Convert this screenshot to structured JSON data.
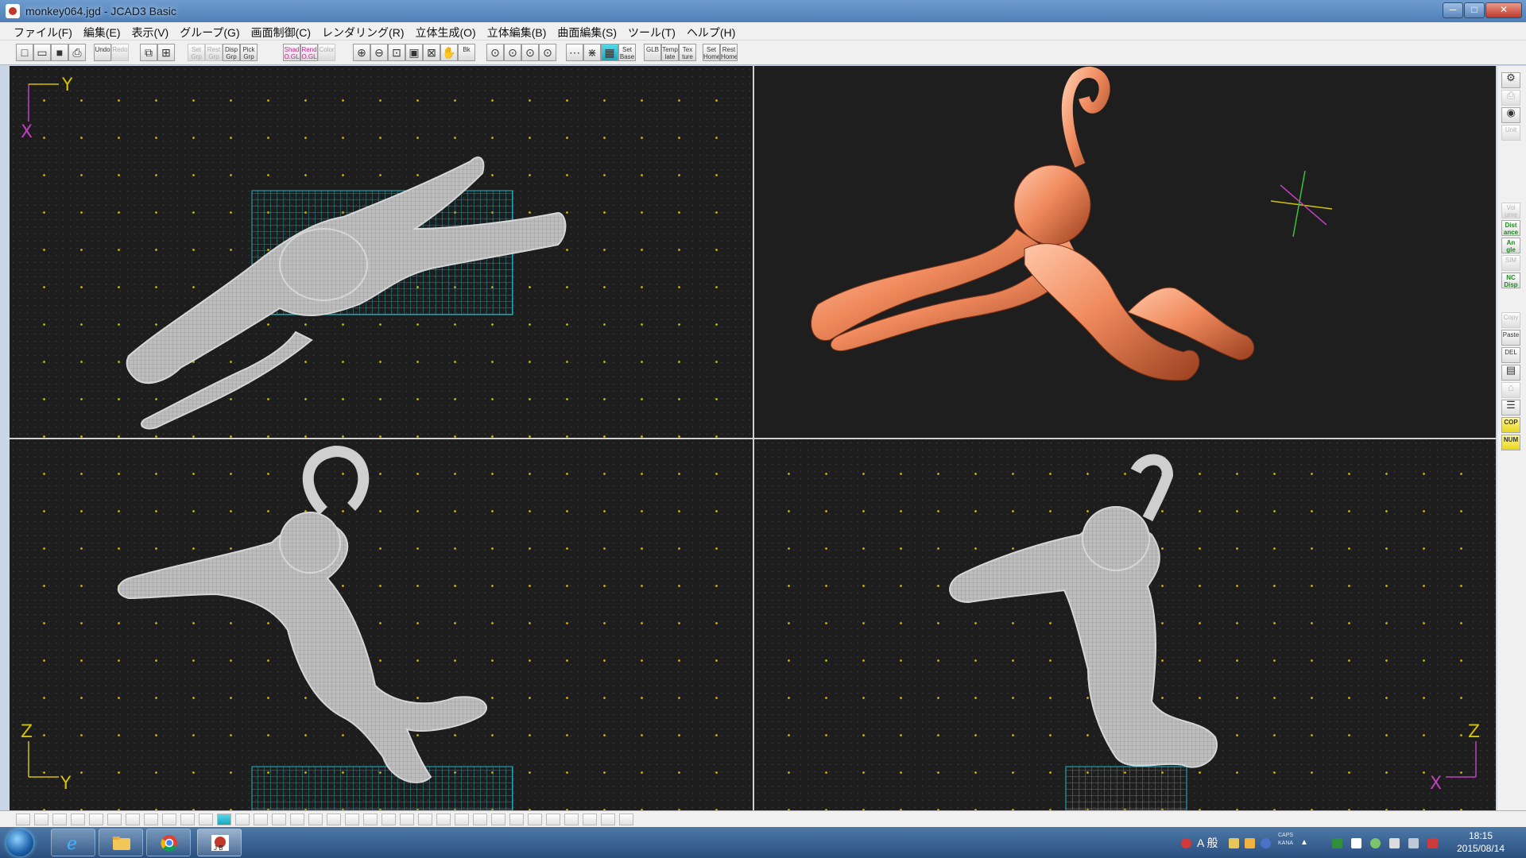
{
  "window": {
    "title": "monkey064.jgd - JCAD3 Basic",
    "controls": {
      "minimize": "─",
      "maximize": "□",
      "close": "✕"
    }
  },
  "menu": [
    "ファイル(F)",
    "編集(E)",
    "表示(V)",
    "グループ(G)",
    "画面制御(C)",
    "レンダリング(R)",
    "立体生成(O)",
    "立体編集(B)",
    "曲面編集(S)",
    "ツール(T)",
    "ヘルプ(H)"
  ],
  "toolbar": [
    {
      "name": "new-file-button",
      "label": "",
      "icon": "new-icon"
    },
    {
      "name": "open-file-button",
      "label": "",
      "icon": "folder-open-icon"
    },
    {
      "name": "save-file-button",
      "label": "",
      "icon": "save-icon"
    },
    {
      "name": "print-button",
      "label": "",
      "icon": "printer-icon"
    },
    {
      "name": "undo-button",
      "label": "Undo",
      "state": "normal"
    },
    {
      "name": "redo-button",
      "label": "Redo",
      "state": "dim"
    },
    {
      "name": "copy-view-button",
      "label": "",
      "icon": "copy-icon"
    },
    {
      "name": "layout-button",
      "label": "",
      "icon": "grid-icon"
    },
    {
      "name": "set-grp-button",
      "label": "Set Grp",
      "state": "dim"
    },
    {
      "name": "rest-grp-button",
      "label": "Rest Grp",
      "state": "dim"
    },
    {
      "name": "disp-grp-button",
      "label": "Disp Grp",
      "state": "normal"
    },
    {
      "name": "pick-grp-button",
      "label": "Pick Grp",
      "state": "normal"
    },
    {
      "name": "shad-ogl-button",
      "label": "Shad O.GL",
      "state": "pink"
    },
    {
      "name": "rend-ogl-button",
      "label": "Rend O.GL",
      "state": "pink"
    },
    {
      "name": "color-button",
      "label": "Color",
      "state": "dim"
    },
    {
      "name": "zoom-in-button",
      "label": "",
      "icon": "zoom-in-icon"
    },
    {
      "name": "zoom-out-button",
      "label": "",
      "icon": "zoom-out-icon"
    },
    {
      "name": "zoom-window-button",
      "label": "",
      "icon": "zoom-window-icon"
    },
    {
      "name": "zoom-all-button",
      "label": "",
      "icon": "zoom-all-icon"
    },
    {
      "name": "zoom-fit-button",
      "label": "",
      "icon": "zoom-fit-icon"
    },
    {
      "name": "pan-button",
      "label": "",
      "icon": "hand-icon"
    },
    {
      "name": "back-button",
      "label": "Bk",
      "icon": "back-icon"
    },
    {
      "name": "zoom-red-1-button",
      "label": "",
      "icon": "zoom-red-icon"
    },
    {
      "name": "zoom-red-2-button",
      "label": "",
      "icon": "zoom-red-icon"
    },
    {
      "name": "zoom-red-3-button",
      "label": "",
      "icon": "zoom-red-icon"
    },
    {
      "name": "zoom-red-4-button",
      "label": "",
      "icon": "zoom-red-icon"
    },
    {
      "name": "grid-dots-button",
      "label": "",
      "icon": "grid-dots-icon"
    },
    {
      "name": "grid-cross-button",
      "label": "",
      "icon": "grid-cross-icon"
    },
    {
      "name": "grid-active-button",
      "label": "",
      "icon": "grid-active-icon",
      "state": "active"
    },
    {
      "name": "set-base-button",
      "label": "Set Base",
      "state": "normal"
    },
    {
      "name": "glb-button",
      "label": "GLB",
      "state": "normal"
    },
    {
      "name": "template-button",
      "label": "Temp late",
      "state": "normal"
    },
    {
      "name": "texture-button",
      "label": "Tex ture",
      "state": "normal"
    },
    {
      "name": "set-home-button",
      "label": "Set Home",
      "state": "normal"
    },
    {
      "name": "rest-home-button",
      "label": "Rest Home",
      "state": "normal"
    }
  ],
  "rightTools": [
    {
      "name": "gear-tool",
      "label": "",
      "icon": "gear-icon",
      "state": "normal"
    },
    {
      "name": "printer-tool",
      "label": "",
      "icon": "printer-icon",
      "state": "dim"
    },
    {
      "name": "eye-tool",
      "label": "",
      "icon": "eye-icon",
      "state": "normal"
    },
    {
      "name": "unit-tool",
      "label": "Unit",
      "state": "dim"
    },
    {
      "name": "volume-tool",
      "label": "Vol ume",
      "state": "dim"
    },
    {
      "name": "distance-tool",
      "label": "Dist ance",
      "state": "green"
    },
    {
      "name": "angle-tool",
      "label": "An gle",
      "state": "green"
    },
    {
      "name": "sim-tool",
      "label": "SIM",
      "state": "dim"
    },
    {
      "name": "nc-disp-tool",
      "label": "NC Disp",
      "state": "green"
    },
    {
      "name": "copy-tool",
      "label": "Copy",
      "state": "dim"
    },
    {
      "name": "paste-tool",
      "label": "Paste",
      "state": "normal"
    },
    {
      "name": "delete-tool",
      "label": "DEL",
      "state": "normal"
    },
    {
      "name": "layers-tool",
      "label": "",
      "icon": "layers-icon",
      "state": "normal"
    },
    {
      "name": "lock-tool",
      "label": "",
      "icon": "lock-icon",
      "state": "dim"
    },
    {
      "name": "tree-tool",
      "label": "",
      "icon": "tree-icon",
      "state": "normal"
    },
    {
      "name": "cop-tool",
      "label": "COP",
      "state": "yellow"
    },
    {
      "name": "num-tool",
      "label": "NUM",
      "state": "yellow"
    }
  ],
  "viewports": {
    "top_left": {
      "axis": {
        "horizontal": "Y",
        "vertical": "X"
      },
      "mode": "wireframe"
    },
    "top_right": {
      "mode": "shaded",
      "model_color": "#f08a5d"
    },
    "bottom_left": {
      "axis": {
        "horizontal": "Y",
        "vertical": "Z"
      },
      "mode": "wireframe"
    },
    "bottom_right": {
      "axis": {
        "horizontal": "X",
        "vertical": "Z"
      },
      "mode": "wireframe"
    }
  },
  "colors": {
    "grid_dot": "#c8b400",
    "axis_y_line": "#d4c200",
    "axis_x_line": "#c040c0",
    "selection_grid": "#1fb5c8",
    "wireframe": "#d6d6d6",
    "model_orange": "#f08a5d"
  },
  "taskbar": {
    "apps": [
      {
        "name": "ie-task",
        "icon": "ie-icon"
      },
      {
        "name": "explorer-task",
        "icon": "folder-icon"
      },
      {
        "name": "chrome-task",
        "icon": "chrome-icon"
      },
      {
        "name": "jcad-task",
        "icon": "jcad-icon",
        "active": true
      }
    ],
    "ime": "A 般",
    "caps": "CAPS",
    "kana": "KANA",
    "clock": {
      "time": "18:15",
      "date": "2015/08/14"
    }
  }
}
